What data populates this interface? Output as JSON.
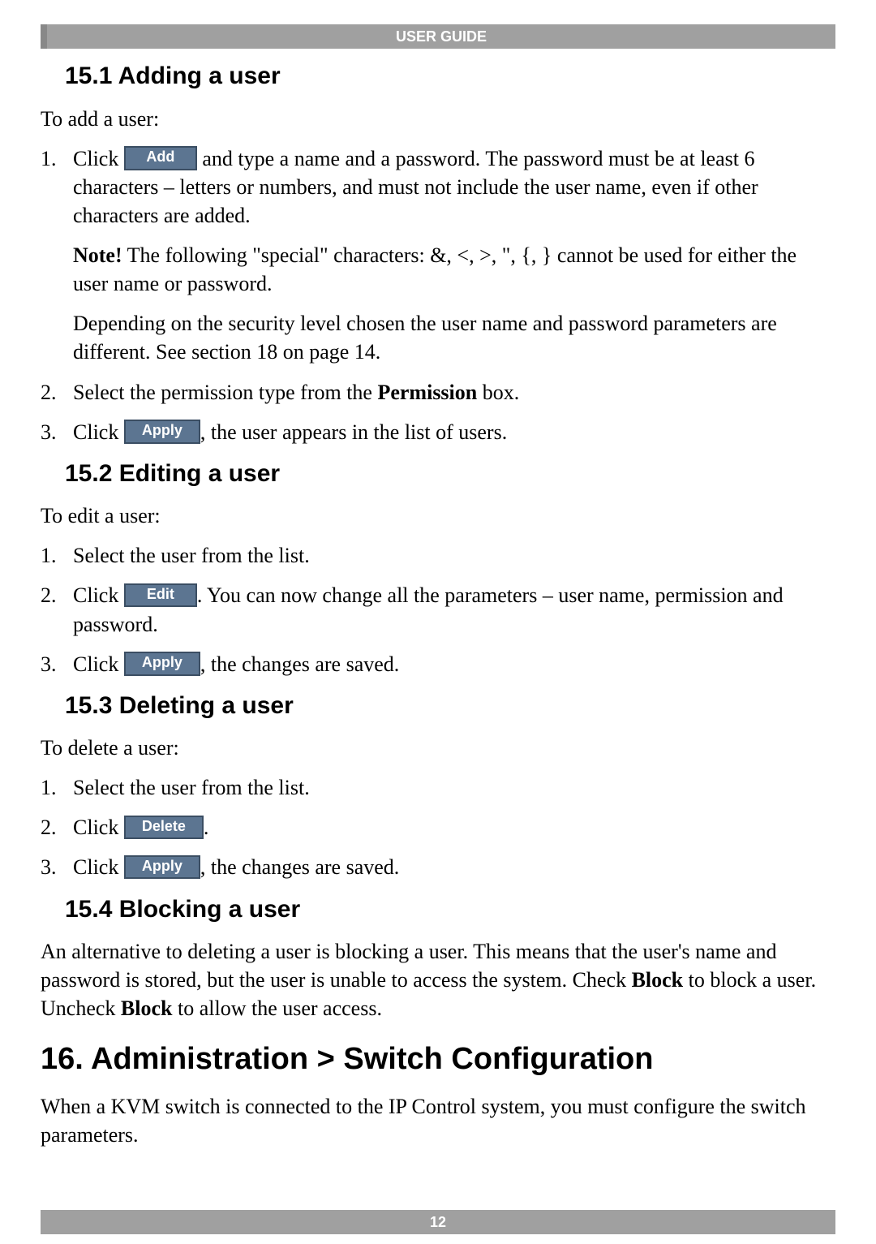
{
  "header": {
    "title": "USER GUIDE"
  },
  "footer": {
    "page": "12"
  },
  "sections": {
    "s151": {
      "heading": "15.1 Adding a user",
      "intro": "To add a user:",
      "step1_pre": "Click ",
      "step1_btn": "Add",
      "step1_post": " and type a name and a password. The password must be at least 6 characters – letters or numbers, and must not include the user name, even if other characters are added.",
      "note_label": "Note!",
      "note_text": " The following \"special\" characters: &, <, >, \", {, } cannot be used for either the user name or password.",
      "depend": "Depending on the security level chosen the user name and password parameters are different. See section 18 on page 14.",
      "step2_pre": "Select the permission type from the ",
      "step2_bold": "Permission",
      "step2_post": " box.",
      "step3_pre": "Click ",
      "step3_btn": "Apply",
      "step3_post": ", the user appears in the list of users."
    },
    "s152": {
      "heading": "15.2 Editing a user",
      "intro": "To edit a user:",
      "step1": "Select the user from the list.",
      "step2_pre": "Click ",
      "step2_btn": "Edit",
      "step2_post": ". You can now change all the parameters – user name, permission and password.",
      "step3_pre": "Click ",
      "step3_btn": "Apply",
      "step3_post": ", the changes are saved."
    },
    "s153": {
      "heading": "15.3 Deleting a user",
      "intro": "To delete a user:",
      "step1": "Select the user from the list.",
      "step2_pre": "Click ",
      "step2_btn": "Delete",
      "step2_post": ".",
      "step3_pre": "Click ",
      "step3_btn": "Apply",
      "step3_post": ", the changes are saved."
    },
    "s154": {
      "heading": "15.4 Blocking a user",
      "para_a": "An alternative to deleting a user is blocking a user. This means that the user's name and password is stored, but the user is unable to access the system. Check ",
      "bold_block1": "Block",
      "para_b": " to block a user. Uncheck ",
      "bold_block2": "Block",
      "para_c": " to allow the user access."
    },
    "s16": {
      "heading": "16. Administration > Switch Configuration",
      "para": "When a KVM switch is connected to the IP Control system, you must configure the switch parameters."
    }
  }
}
